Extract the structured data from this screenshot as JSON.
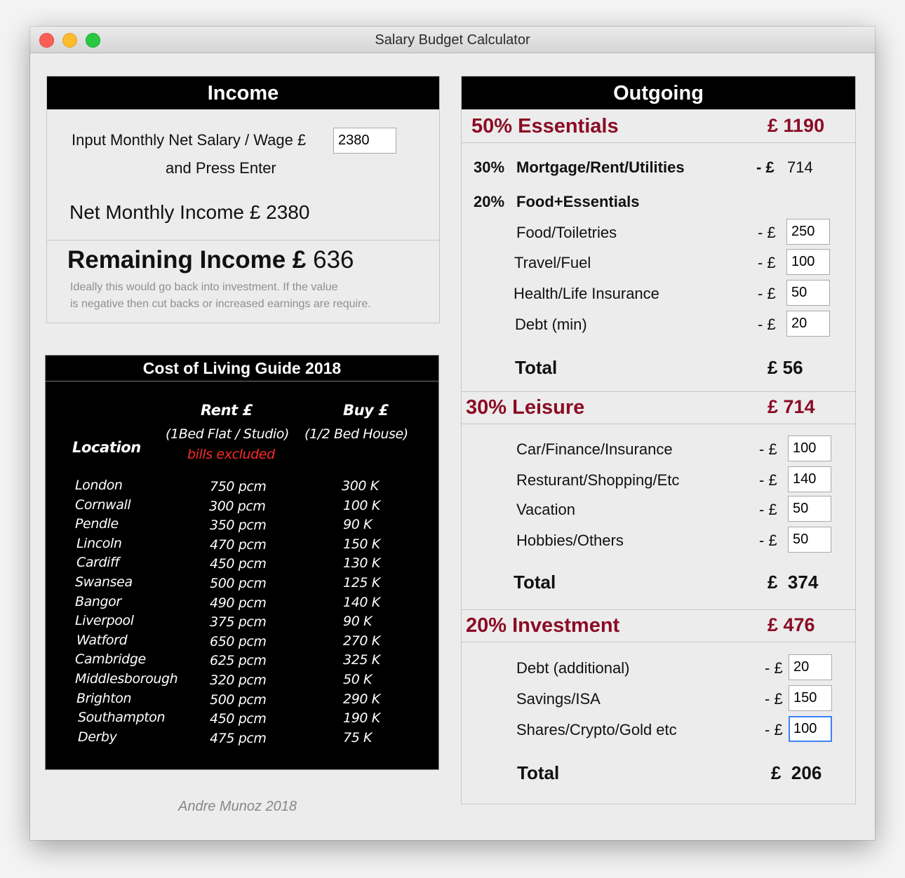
{
  "window": {
    "title": "Salary Budget Calculator"
  },
  "income": {
    "header": "Income",
    "prompt": "Input Monthly Net Salary / Wage £",
    "salary_value": "2380",
    "prompt2": "and Press Enter",
    "net_income": "Net Monthly Income £ 2380",
    "remaining_label": "Remaining Income £",
    "remaining_value": "636",
    "note_line1": "Ideally this would go back into investment. If the value",
    "note_line2": "is negative then cut backs or increased earnings are require."
  },
  "guide": {
    "title": "Cost of Living Guide 2018",
    "col_location": "Location",
    "col_rent": "Rent £",
    "col_rent_sub": "(1Bed Flat / Studio)",
    "col_rent_note": "bills excluded",
    "col_buy": "Buy £",
    "col_buy_sub": "(1/2 Bed House)",
    "rows": [
      {
        "location": "London",
        "rent": "750 pcm",
        "buy": "300 K"
      },
      {
        "location": "Cornwall",
        "rent": "300 pcm",
        "buy": "100 K"
      },
      {
        "location": "Pendle",
        "rent": "350 pcm",
        "buy": "90 K"
      },
      {
        "location": "Lincoln",
        "rent": "470 pcm",
        "buy": "150 K"
      },
      {
        "location": "Cardiff",
        "rent": "450 pcm",
        "buy": "130 K"
      },
      {
        "location": "Swansea",
        "rent": "500 pcm",
        "buy": "125 K"
      },
      {
        "location": "Bangor",
        "rent": "490 pcm",
        "buy": "140 K"
      },
      {
        "location": "Liverpool",
        "rent": "375 pcm",
        "buy": "90 K"
      },
      {
        "location": "Watford",
        "rent": "650 pcm",
        "buy": "270 K"
      },
      {
        "location": "Cambridge",
        "rent": "625 pcm",
        "buy": "325 K"
      },
      {
        "location": "Middlesborough",
        "rent": "320 pcm",
        "buy": "50 K"
      },
      {
        "location": "Brighton",
        "rent": "500 pcm",
        "buy": "290 K"
      },
      {
        "location": "Southampton",
        "rent": "450 pcm",
        "buy": "190 K"
      },
      {
        "location": "Derby",
        "rent": "475 pcm",
        "buy": "75 K"
      }
    ]
  },
  "credit": "Andre Munoz 2018",
  "outgoing": {
    "header": "Outgoing",
    "essentials": {
      "title": "50% Essentials",
      "amount": "£ 1190",
      "mortgage_pct": "30%",
      "mortgage_label": "Mortgage/Rent/Utilities",
      "mortgage_prefix": "- £",
      "mortgage_value": "714",
      "food_pct": "20%",
      "food_label": "Food+Essentials",
      "items": [
        {
          "label": "Food/Toiletries",
          "prefix": "- £",
          "value": "250"
        },
        {
          "label": "Travel/Fuel",
          "prefix": "- £",
          "value": "100"
        },
        {
          "label": "Health/Life Insurance",
          "prefix": "- £",
          "value": "50"
        },
        {
          "label": "Debt (min)",
          "prefix": "- £",
          "value": "20"
        }
      ],
      "total_label": "Total",
      "total_value": "£ 56"
    },
    "leisure": {
      "title": "30% Leisure",
      "amount": "£ 714",
      "items": [
        {
          "label": "Car/Finance/Insurance",
          "prefix": "- £",
          "value": "100"
        },
        {
          "label": "Resturant/Shopping/Etc",
          "prefix": "- £",
          "value": "140"
        },
        {
          "label": "Vacation",
          "prefix": "- £",
          "value": "50"
        },
        {
          "label": "Hobbies/Others",
          "prefix": "- £",
          "value": "50"
        }
      ],
      "total_label": "Total",
      "total_value": "£  374"
    },
    "investment": {
      "title": "20% Investment",
      "amount": "£ 476",
      "items": [
        {
          "label": "Debt (additional)",
          "prefix": "- £",
          "value": "20"
        },
        {
          "label": "Savings/ISA",
          "prefix": "- £",
          "value": "150"
        },
        {
          "label": "Shares/Crypto/Gold etc",
          "prefix": "- £",
          "value": "100"
        }
      ],
      "total_label": "Total",
      "total_value": "£  206"
    }
  }
}
